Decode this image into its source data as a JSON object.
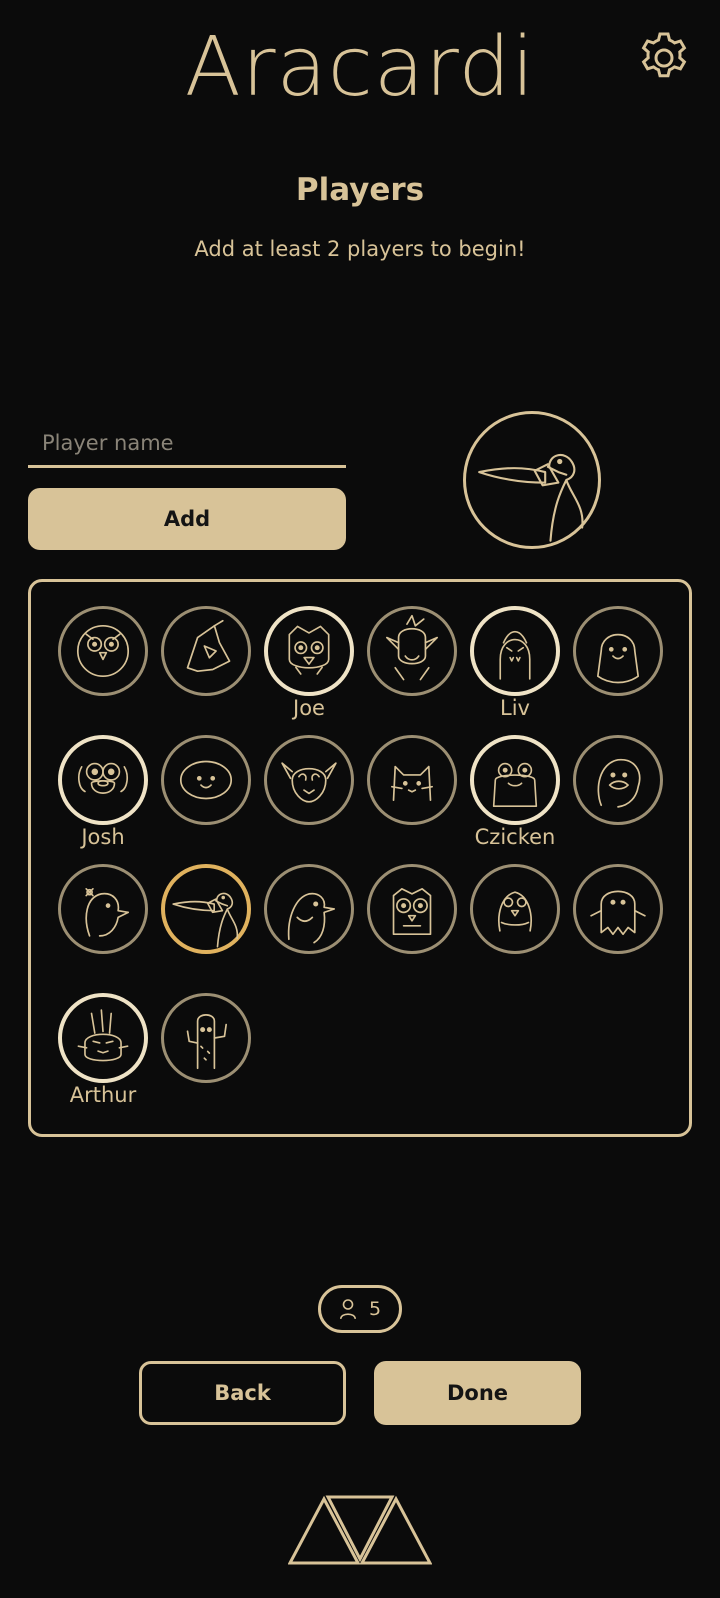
{
  "app": {
    "title": "Aracardi"
  },
  "header": {
    "settings_icon": "gear-icon"
  },
  "players": {
    "title": "Players",
    "subtitle": "Add at least 2 players to begin!",
    "name_input": {
      "placeholder": "Player name",
      "value": ""
    },
    "add_label": "Add",
    "preview_avatar": "duck-with-knife"
  },
  "avatars": [
    {
      "icon": "owl",
      "name": ""
    },
    {
      "icon": "crow",
      "name": ""
    },
    {
      "icon": "owl-king",
      "name": "Joe"
    },
    {
      "icon": "troll",
      "name": ""
    },
    {
      "icon": "marceline",
      "name": "Liv"
    },
    {
      "icon": "lumpy",
      "name": ""
    },
    {
      "icon": "dog-jake",
      "name": "Josh"
    },
    {
      "icon": "finn",
      "name": ""
    },
    {
      "icon": "demon",
      "name": ""
    },
    {
      "icon": "cat",
      "name": ""
    },
    {
      "icon": "frog",
      "name": "Czicken"
    },
    {
      "icon": "duck",
      "name": ""
    },
    {
      "icon": "duck-flower",
      "name": ""
    },
    {
      "icon": "duck-with-knife",
      "name": ""
    },
    {
      "icon": "pigeon",
      "name": ""
    },
    {
      "icon": "owl-glasses",
      "name": ""
    },
    {
      "icon": "bird",
      "name": ""
    },
    {
      "icon": "ghost",
      "name": ""
    },
    {
      "icon": "rabbit",
      "name": "Arthur"
    },
    {
      "icon": "cactus",
      "name": ""
    }
  ],
  "footer": {
    "player_count": "5",
    "player_count_icon": "person-icon",
    "back_label": "Back",
    "done_label": "Done",
    "logo": "triangles-logo"
  },
  "colors": {
    "background": "#0b0b0b",
    "accent": "#d8c398",
    "selected_ring": "#e0b25e",
    "taken_ring": "#efe3c6",
    "free_ring": "#9c8f73"
  }
}
